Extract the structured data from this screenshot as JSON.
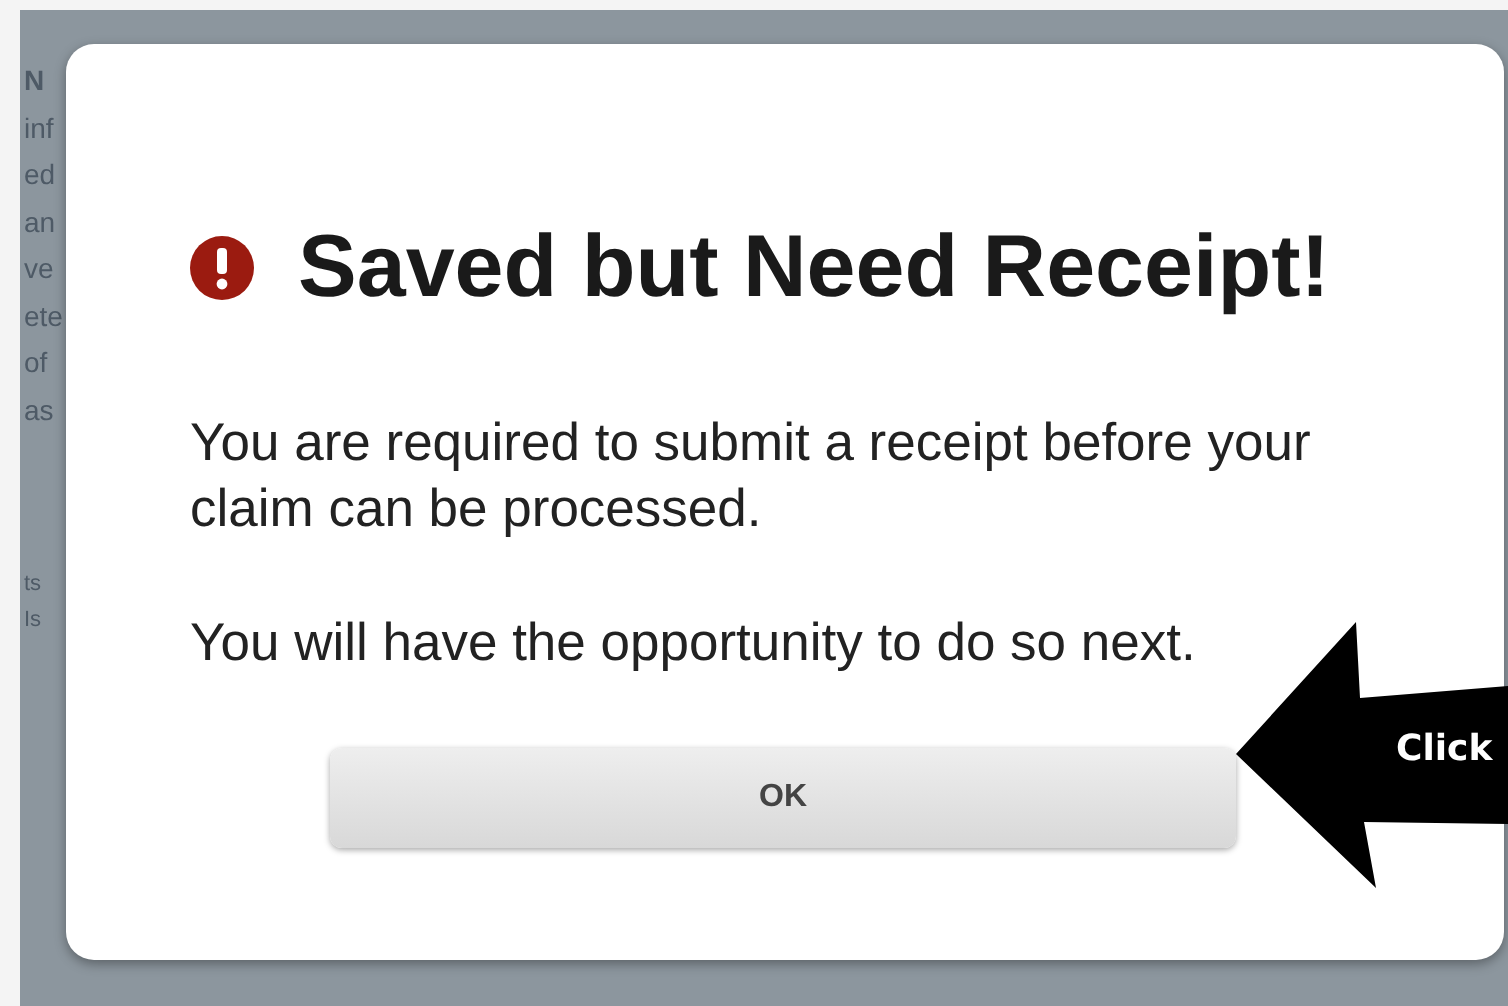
{
  "background_fragments": [
    {
      "text": "N",
      "kind": "heading"
    },
    {
      "text": "inf",
      "kind": "body"
    },
    {
      "text": "ed",
      "kind": "body"
    },
    {
      "text": "an",
      "kind": "body"
    },
    {
      "text": "ve",
      "kind": "body"
    },
    {
      "text": "ete",
      "kind": "body"
    },
    {
      "text": "of",
      "kind": "body"
    },
    {
      "text": "as",
      "kind": "body"
    },
    {
      "text": "ts",
      "kind": "note"
    },
    {
      "text": "Is",
      "kind": "note"
    }
  ],
  "dialog": {
    "title": "Saved but Need Receipt!",
    "paragraphs": [
      "You are required to submit a receipt before your claim can be processed.",
      "You will have the opportunity to do so next."
    ],
    "button": "OK"
  },
  "callout": {
    "text": "Click"
  }
}
